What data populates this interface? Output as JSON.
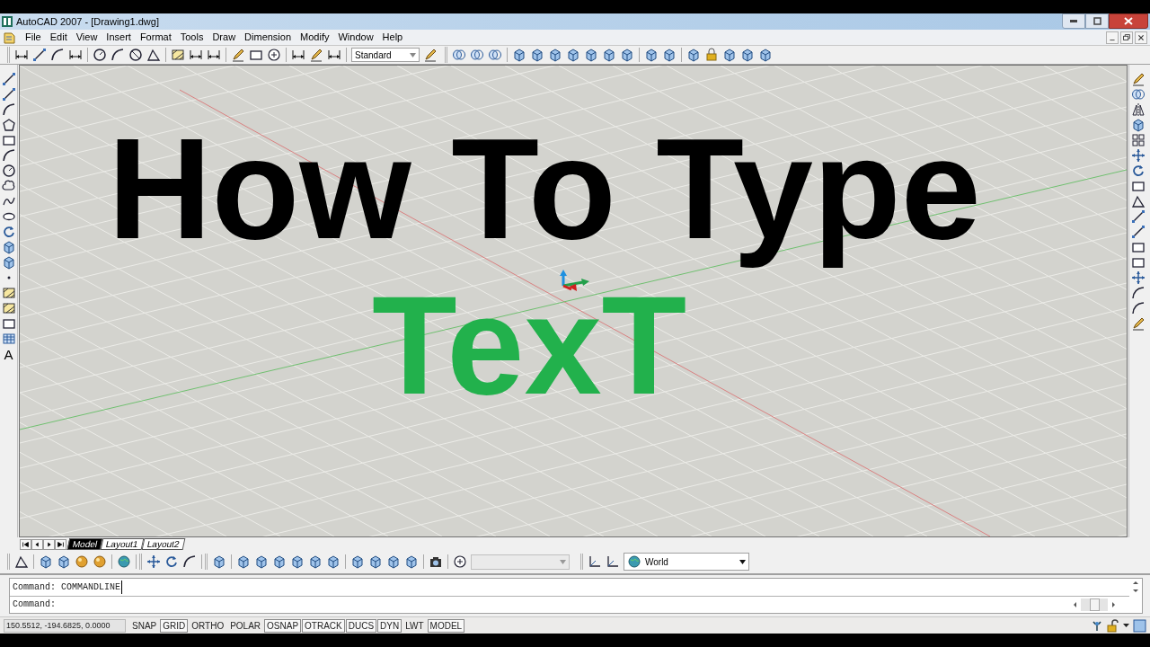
{
  "window": {
    "title": "AutoCAD 2007 - [Drawing1.dwg]"
  },
  "menu": [
    "File",
    "Edit",
    "View",
    "Insert",
    "Format",
    "Tools",
    "Draw",
    "Dimension",
    "Modify",
    "Window",
    "Help"
  ],
  "toolbar": {
    "text_style": "Standard"
  },
  "draw_toolbar": {
    "text_tool": "A"
  },
  "canvas": {
    "texts": [
      {
        "text": "How To Type",
        "color": "#000000"
      },
      {
        "text": "TexT",
        "color": "#22b14c"
      }
    ]
  },
  "layout_tabs": [
    {
      "label": "Model",
      "selected": true
    },
    {
      "label": "Layout1",
      "selected": false
    },
    {
      "label": "Layout2",
      "selected": false
    }
  ],
  "view_toolbar": {
    "ucs": "World"
  },
  "command_lines": [
    "Command: COMMANDLINE",
    "Command:"
  ],
  "status_bar": {
    "coordinates": "150.5512, -194.6825, 0.0000",
    "toggles": [
      {
        "label": "SNAP",
        "on": false
      },
      {
        "label": "GRID",
        "on": true
      },
      {
        "label": "ORTHO",
        "on": false
      },
      {
        "label": "POLAR",
        "on": false
      },
      {
        "label": "OSNAP",
        "on": true
      },
      {
        "label": "OTRACK",
        "on": true
      },
      {
        "label": "DUCS",
        "on": true
      },
      {
        "label": "DYN",
        "on": true
      },
      {
        "label": "LWT",
        "on": false
      },
      {
        "label": "MODEL",
        "on": true
      }
    ]
  }
}
